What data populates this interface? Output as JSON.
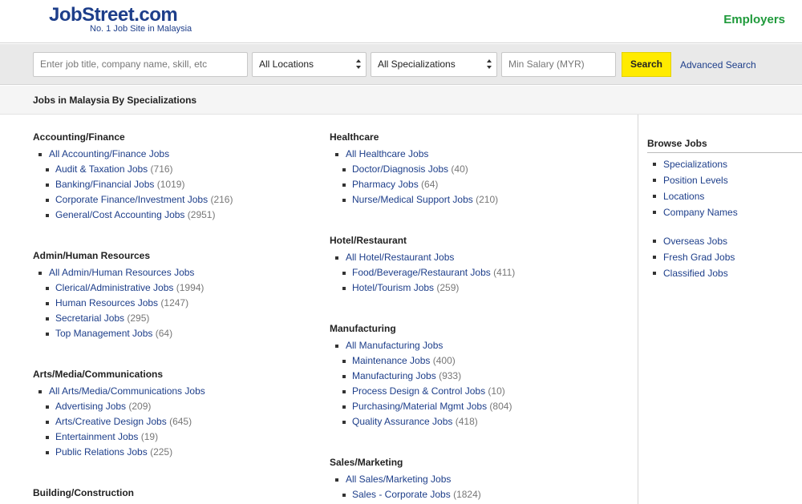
{
  "header": {
    "logo_text": "JobStreet.com",
    "tagline": "No. 1 Job Site in Malaysia",
    "employers_link": "Employers"
  },
  "search": {
    "keyword_placeholder": "Enter job title, company name, skill, etc",
    "location_value": "All Locations",
    "specialization_value": "All Specializations",
    "salary_placeholder": "Min Salary (MYR)",
    "search_button": "Search",
    "advanced_link": "Advanced Search"
  },
  "section_title": "Jobs in Malaysia By Specializations",
  "columns": [
    {
      "groups": [
        {
          "title": "Accounting/Finance",
          "all": "All Accounting/Finance Jobs",
          "items": [
            {
              "label": "Audit & Taxation Jobs",
              "count": "(716)"
            },
            {
              "label": "Banking/Financial Jobs",
              "count": "(1019)"
            },
            {
              "label": "Corporate Finance/Investment Jobs",
              "count": "(216)"
            },
            {
              "label": "General/Cost Accounting Jobs",
              "count": "(2951)"
            }
          ]
        },
        {
          "title": "Admin/Human Resources",
          "all": "All Admin/Human Resources Jobs",
          "items": [
            {
              "label": "Clerical/Administrative Jobs",
              "count": "(1994)"
            },
            {
              "label": "Human Resources Jobs",
              "count": "(1247)"
            },
            {
              "label": "Secretarial Jobs",
              "count": "(295)"
            },
            {
              "label": "Top Management Jobs",
              "count": "(64)"
            }
          ]
        },
        {
          "title": "Arts/Media/Communications",
          "all": "All Arts/Media/Communications Jobs",
          "items": [
            {
              "label": "Advertising Jobs",
              "count": "(209)"
            },
            {
              "label": "Arts/Creative Design Jobs",
              "count": "(645)"
            },
            {
              "label": "Entertainment Jobs",
              "count": "(19)"
            },
            {
              "label": "Public Relations Jobs",
              "count": "(225)"
            }
          ]
        },
        {
          "title": "Building/Construction",
          "all": "",
          "items": []
        }
      ]
    },
    {
      "groups": [
        {
          "title": "Healthcare",
          "all": "All Healthcare Jobs",
          "items": [
            {
              "label": "Doctor/Diagnosis Jobs",
              "count": "(40)"
            },
            {
              "label": "Pharmacy Jobs",
              "count": "(64)"
            },
            {
              "label": "Nurse/Medical Support Jobs",
              "count": "(210)"
            }
          ]
        },
        {
          "title": "Hotel/Restaurant",
          "all": "All Hotel/Restaurant Jobs",
          "items": [
            {
              "label": "Food/Beverage/Restaurant Jobs",
              "count": "(411)"
            },
            {
              "label": "Hotel/Tourism Jobs",
              "count": "(259)"
            }
          ]
        },
        {
          "title": "Manufacturing",
          "all": "All Manufacturing Jobs",
          "items": [
            {
              "label": "Maintenance Jobs",
              "count": "(400)"
            },
            {
              "label": "Manufacturing Jobs",
              "count": "(933)"
            },
            {
              "label": "Process Design & Control Jobs",
              "count": "(10)"
            },
            {
              "label": "Purchasing/Material Mgmt Jobs",
              "count": "(804)"
            },
            {
              "label": "Quality Assurance Jobs",
              "count": "(418)"
            }
          ]
        },
        {
          "title": "Sales/Marketing",
          "all": "All Sales/Marketing Jobs",
          "items": [
            {
              "label": "Sales - Corporate Jobs",
              "count": "(1824)"
            }
          ]
        }
      ]
    }
  ],
  "sidebar": {
    "title": "Browse Jobs",
    "links_a": [
      "Specializations",
      "Position Levels",
      "Locations",
      "Company Names"
    ],
    "links_b": [
      "Overseas Jobs",
      "Fresh Grad Jobs",
      "Classified Jobs"
    ]
  },
  "colors": {
    "link": "#1d3e8a",
    "employers": "#1f9a3b",
    "search_button": "#ffeb00",
    "count": "#777777"
  }
}
